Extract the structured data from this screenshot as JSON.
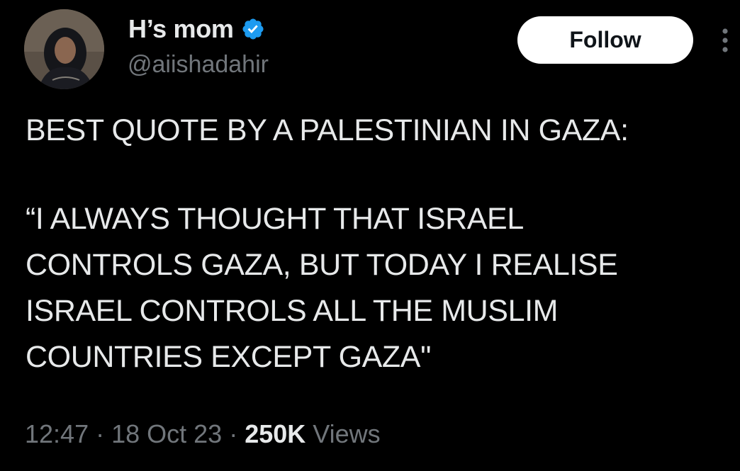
{
  "author": {
    "display_name": "H’s mom",
    "handle": "@aiishadahir",
    "verified": true,
    "avatar_icon": "profile-photo"
  },
  "actions": {
    "follow_label": "Follow",
    "more_icon": "more-vertical-icon"
  },
  "tweet": {
    "lines": [
      "BEST QUOTE BY A PALESTINIAN IN GAZA:",
      "“I ALWAYS THOUGHT THAT ISRAEL",
      "CONTROLS GAZA, BUT TODAY I REALISE",
      "ISRAEL CONTROLS ALL THE MUSLIM",
      "COUNTRIES EXCEPT GAZA\""
    ]
  },
  "meta": {
    "time": "12:47",
    "separator": " · ",
    "date": "18 Oct 23",
    "views_count": "250K",
    "views_label": " Views"
  },
  "colors": {
    "background": "#000000",
    "text_primary": "#e7e9ea",
    "text_secondary": "#71767b",
    "verified_badge": "#1d9bf0",
    "follow_button_bg": "#ffffff"
  }
}
